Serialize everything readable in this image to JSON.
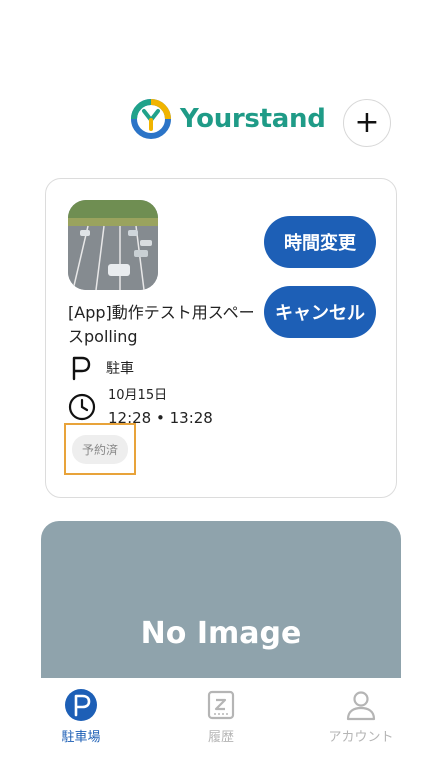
{
  "header": {
    "brand": "Yourstand",
    "add_label": "+"
  },
  "reservation": {
    "space_name": "[App]動作テスト用スペースpolling",
    "type": "駐車",
    "date": "10月15日",
    "time_range": "12:28 • 13:28",
    "status": "予約済",
    "change_time_label": "時間変更",
    "cancel_label": "キャンセル"
  },
  "placeholder": {
    "text": "No Image"
  },
  "tabs": [
    {
      "label": "駐車場",
      "icon": "parking-icon",
      "active": true
    },
    {
      "label": "履歴",
      "icon": "history-icon",
      "active": false
    },
    {
      "label": "アカウント",
      "icon": "account-icon",
      "active": false
    }
  ],
  "colors": {
    "primary": "#1d5fb6",
    "brand_green": "#1f9b87",
    "status_highlight": "#e8a33a",
    "placeholder_bg": "#8fa3ac"
  }
}
